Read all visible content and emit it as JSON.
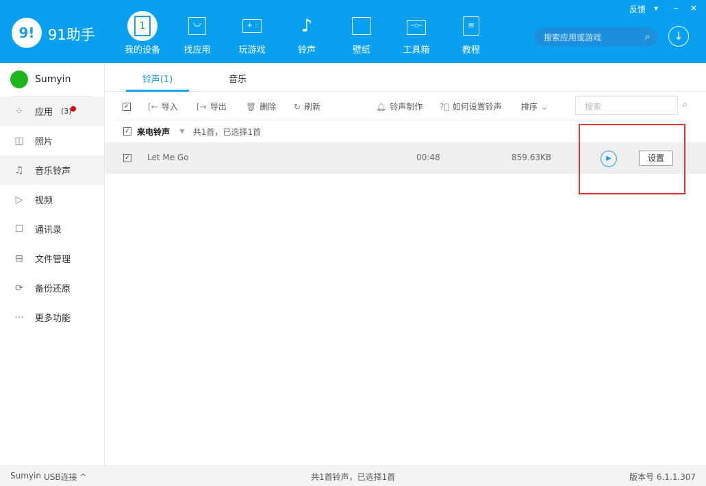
{
  "header": {
    "logo_mark": "9!",
    "app_name": "91助手",
    "feedback": "反馈",
    "menu_icon": "▾",
    "minimize": "–",
    "close": "✕",
    "nav": [
      {
        "label": "我的设备",
        "icon": "1"
      },
      {
        "label": "找应用",
        "icon": "bag"
      },
      {
        "label": "玩游戏",
        "icon": "gamepad"
      },
      {
        "label": "铃声",
        "icon": "music"
      },
      {
        "label": "壁纸",
        "icon": "picture"
      },
      {
        "label": "工具箱",
        "icon": "toolbox"
      },
      {
        "label": "教程",
        "icon": "clipboard"
      }
    ],
    "search_placeholder": "搜索应用或游戏"
  },
  "sidebar": {
    "device": "Sumyin",
    "items": [
      {
        "label": "应用",
        "badge": "(3)"
      },
      {
        "label": "照片"
      },
      {
        "label": "音乐铃声"
      },
      {
        "label": "视频"
      },
      {
        "label": "通讯录"
      },
      {
        "label": "文件管理"
      },
      {
        "label": "备份还原"
      },
      {
        "label": "更多功能"
      }
    ]
  },
  "tabs": [
    {
      "label": "铃声(1)"
    },
    {
      "label": "音乐"
    }
  ],
  "toolbar": {
    "import": "导入",
    "export": "导出",
    "delete": "删除",
    "refresh": "刷新",
    "make": "铃声制作",
    "howto": "如何设置铃声",
    "sort": "排序",
    "search_placeholder": "搜索"
  },
  "group": {
    "name": "来电铃声",
    "summary": "共1首，已选择1首"
  },
  "rows": [
    {
      "title": "Let Me Go",
      "duration": "00:48",
      "size": "859.63KB",
      "action": "设置"
    }
  ],
  "status": {
    "device": "Sumyin",
    "connection": "USB连接 ^",
    "summary": "共1首铃声，已选择1首",
    "version": "版本号 6.1.1.307"
  },
  "accent": "#08a0f0"
}
